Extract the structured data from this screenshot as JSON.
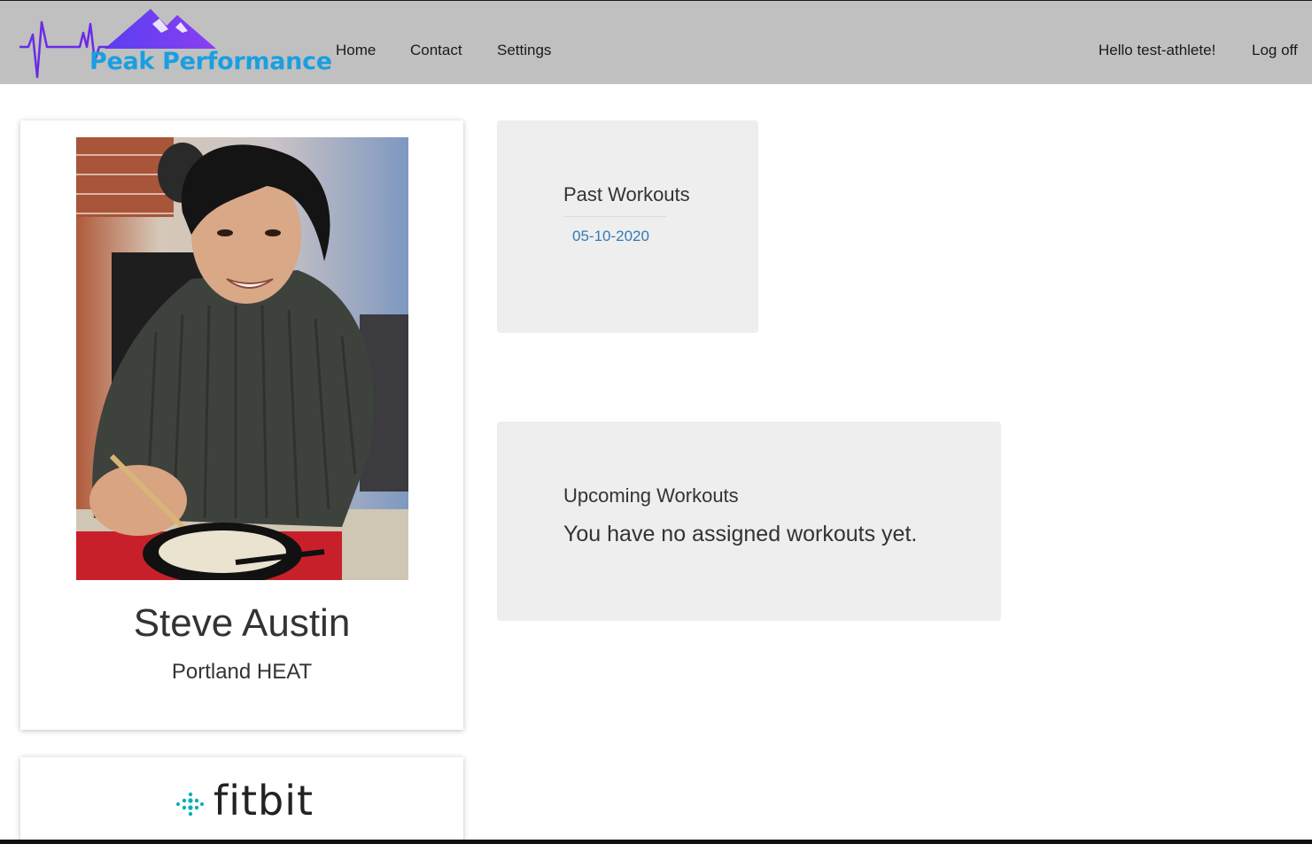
{
  "brand": {
    "name": "Peak Performance",
    "colors": {
      "text": "#1a9fe0",
      "mountain": "#7b3ff2",
      "pulse": "#6a2be8"
    }
  },
  "nav": {
    "links": [
      "Home",
      "Contact",
      "Settings"
    ],
    "greeting": "Hello test-athlete!",
    "logoff": "Log off"
  },
  "profile": {
    "name": "Steve Austin",
    "team": "Portland HEAT",
    "photo_icon": "athlete-photo"
  },
  "fitbit": {
    "label": "fitbit",
    "icon": "fitbit-dots-icon",
    "color": "#00b0b9"
  },
  "past_workouts": {
    "title": "Past Workouts",
    "items": [
      "05-10-2020"
    ]
  },
  "upcoming_workouts": {
    "title": "Upcoming Workouts",
    "empty_message": "You have no assigned workouts yet."
  },
  "colors": {
    "navbar": "#c0c0c0",
    "panel": "#eeeeee",
    "link": "#337ab7"
  }
}
